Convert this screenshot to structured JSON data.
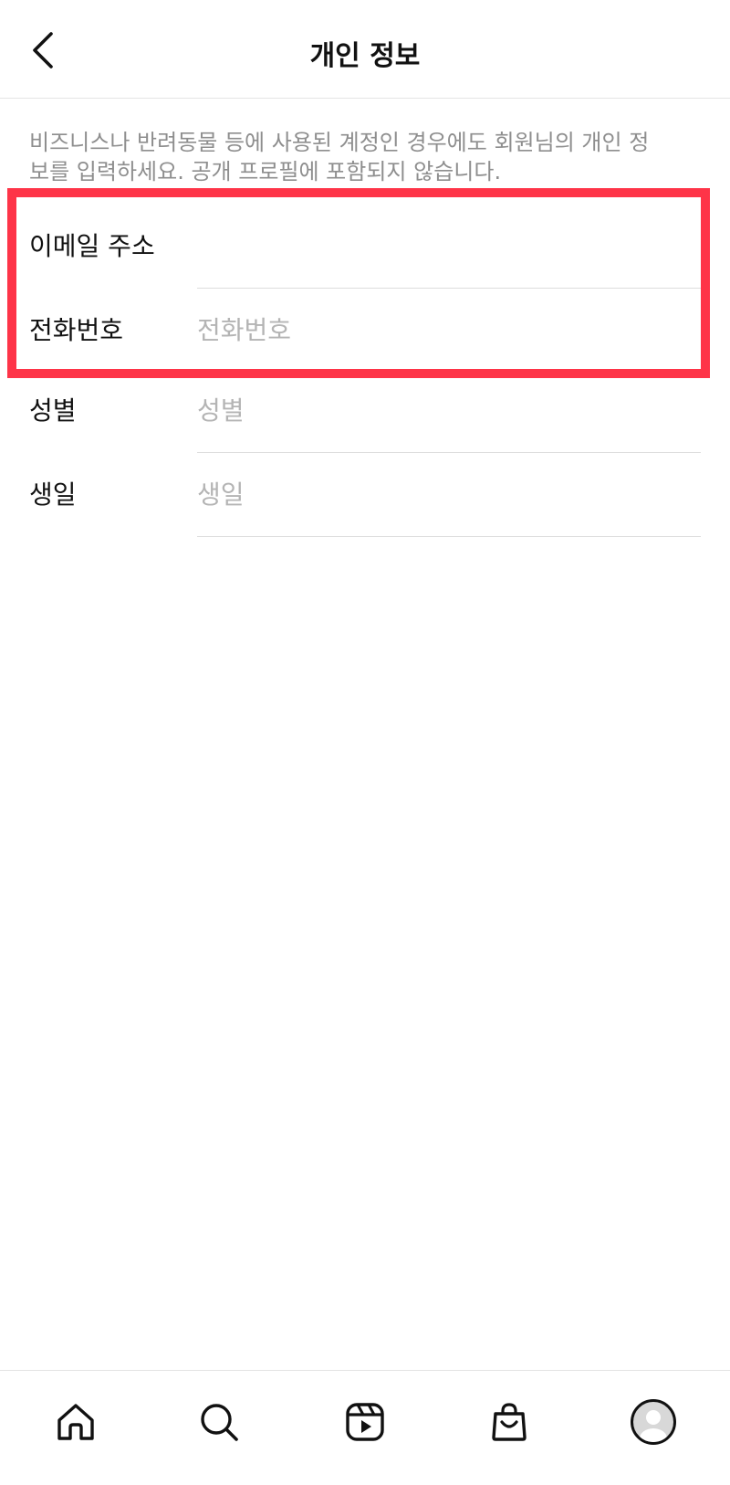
{
  "header": {
    "title": "개인 정보",
    "back_icon": "chevron-left-icon"
  },
  "description": "비즈니스나 반려동물 등에 사용된 계정인 경우에도 회원님의 개인 정보를 입력하세요. 공개 프로필에 포함되지 않습니다.",
  "form": {
    "email": {
      "label": "이메일 주소",
      "value": "",
      "placeholder": ""
    },
    "phone": {
      "label": "전화번호",
      "value": "",
      "placeholder": "전화번호"
    },
    "gender": {
      "label": "성별",
      "value": "",
      "placeholder": "성별"
    },
    "birthday": {
      "label": "생일",
      "value": "",
      "placeholder": "생일"
    }
  },
  "highlight_color": "#fe3448",
  "bottom_nav": [
    {
      "id": "home",
      "icon": "home-icon"
    },
    {
      "id": "search",
      "icon": "search-icon"
    },
    {
      "id": "reels",
      "icon": "reels-icon"
    },
    {
      "id": "shop",
      "icon": "shopping-bag-icon"
    },
    {
      "id": "profile",
      "icon": "profile-avatar-icon"
    }
  ]
}
